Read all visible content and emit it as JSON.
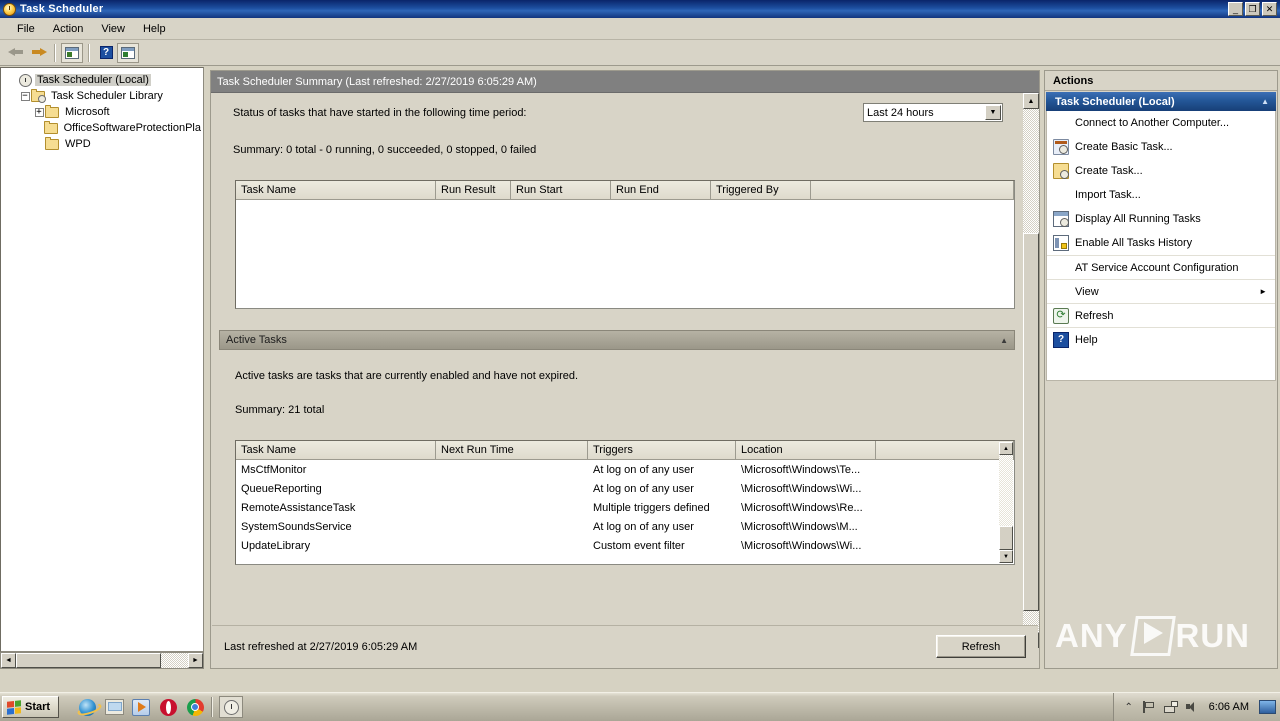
{
  "window": {
    "title": "Task Scheduler",
    "icon": "clock-icon",
    "buttons": {
      "minimize": "_",
      "restore": "❐",
      "close": "✕"
    }
  },
  "menu": {
    "items": [
      "File",
      "Action",
      "View",
      "Help"
    ]
  },
  "toolbar": {
    "items": [
      {
        "name": "back-button",
        "icon": "back-arrow-icon"
      },
      {
        "name": "forward-button",
        "icon": "forward-arrow-icon"
      },
      {
        "name": "show-console-tree-button",
        "icon": "console-tree-icon"
      },
      {
        "name": "help-button",
        "icon": "help-question-icon"
      },
      {
        "name": "properties-button",
        "icon": "properties-icon"
      }
    ]
  },
  "tree": {
    "nodes": [
      {
        "label": "Task Scheduler (Local)",
        "icon": "clock-icon",
        "indent": 0,
        "twisty": "",
        "selected": true
      },
      {
        "label": "Task Scheduler Library",
        "icon": "folder-clock-icon",
        "indent": 1,
        "twisty": "−",
        "selected": false
      },
      {
        "label": "Microsoft",
        "icon": "folder-icon",
        "indent": 2,
        "twisty": "+",
        "selected": false
      },
      {
        "label": "OfficeSoftwareProtectionPla",
        "icon": "folder-icon",
        "indent": 2,
        "twisty": "",
        "selected": false
      },
      {
        "label": "WPD",
        "icon": "folder-icon",
        "indent": 2,
        "twisty": "",
        "selected": false
      }
    ],
    "hscroll": {
      "left_arrow": "◄",
      "right_arrow": "►"
    }
  },
  "center": {
    "header": "Task Scheduler Summary (Last refreshed: 2/27/2019 6:05:29 AM)",
    "status_section": {
      "label": "Status of tasks that have started in the following time period:",
      "period_selected": "Last 24 hours",
      "summary": "Summary: 0 total - 0 running, 0 succeeded, 0 stopped, 0 failed",
      "columns": [
        "Task Name",
        "Run Result",
        "Run Start",
        "Run End",
        "Triggered By"
      ],
      "rows": []
    },
    "active_tasks": {
      "title": "Active Tasks",
      "collapse_glyph": "▲",
      "description": "Active tasks are tasks that are currently enabled and have not expired.",
      "summary": "Summary: 21 total",
      "columns": [
        "Task Name",
        "Next Run Time",
        "Triggers",
        "Location"
      ],
      "rows": [
        {
          "task_name": "MsCtfMonitor",
          "next_run_time": "",
          "triggers": "At log on of any user",
          "location": "\\Microsoft\\Windows\\Te..."
        },
        {
          "task_name": "QueueReporting",
          "next_run_time": "",
          "triggers": "At log on of any user",
          "location": "\\Microsoft\\Windows\\Wi..."
        },
        {
          "task_name": "RemoteAssistanceTask",
          "next_run_time": "",
          "triggers": "Multiple triggers defined",
          "location": "\\Microsoft\\Windows\\Re..."
        },
        {
          "task_name": "SystemSoundsService",
          "next_run_time": "",
          "triggers": "At log on of any user",
          "location": "\\Microsoft\\Windows\\M..."
        },
        {
          "task_name": "UpdateLibrary",
          "next_run_time": "",
          "triggers": "Custom event filter",
          "location": "\\Microsoft\\Windows\\Wi..."
        }
      ]
    },
    "footer": {
      "last_refreshed": "Last refreshed at 2/27/2019 6:05:29 AM",
      "refresh_button": "Refresh"
    },
    "scroll": {
      "up_arrow": "▲",
      "down_arrow": "▼"
    }
  },
  "actions": {
    "title": "Actions",
    "group": {
      "label": "Task Scheduler (Local)",
      "collapse_glyph": "▲"
    },
    "items": [
      {
        "label": "Connect to Another Computer...",
        "icon": "",
        "separator": false
      },
      {
        "label": "Create Basic Task...",
        "icon": "create-basic-task-icon",
        "separator": false
      },
      {
        "label": "Create Task...",
        "icon": "create-task-icon",
        "separator": false
      },
      {
        "label": "Import Task...",
        "icon": "",
        "separator": false
      },
      {
        "label": "Display All Running Tasks",
        "icon": "display-running-tasks-icon",
        "separator": false
      },
      {
        "label": "Enable All Tasks History",
        "icon": "enable-tasks-history-icon",
        "separator": false
      },
      {
        "label": "AT Service Account Configuration",
        "icon": "",
        "separator": true
      },
      {
        "label": "View",
        "icon": "",
        "separator": true,
        "submenu": "►"
      },
      {
        "label": "Refresh",
        "icon": "refresh-icon",
        "separator": true
      },
      {
        "label": "Help",
        "icon": "help-icon",
        "separator": true
      }
    ]
  },
  "watermark": {
    "left": "ANY",
    "right": "RUN"
  },
  "taskbar": {
    "start_label": "Start",
    "quick_launch": [
      {
        "name": "internet-explorer-icon"
      },
      {
        "name": "windows-explorer-icon"
      },
      {
        "name": "media-player-icon"
      },
      {
        "name": "opera-icon"
      },
      {
        "name": "chrome-icon"
      }
    ],
    "windows": [
      {
        "name": "task-scheduler-taskbar-button",
        "icon": "clock-icon"
      }
    ],
    "tray": {
      "chevron": "⌃",
      "icons": [
        "flag-icon",
        "network-icon",
        "volume-icon"
      ],
      "clock": "6:06 AM",
      "show_desktop": "show-desktop-button"
    }
  },
  "colors": {
    "titlebar_blue": "#0a246a",
    "accent_blue": "#245798",
    "face": "#d8d4c7",
    "summary_header_gray": "#808080"
  }
}
